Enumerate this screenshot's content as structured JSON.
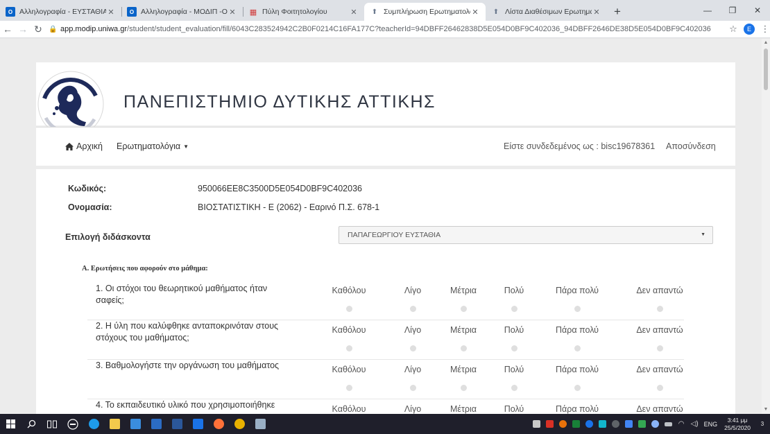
{
  "browser": {
    "tabs": [
      {
        "title": "Αλληλογραφία - ΕΥΣΤΑΘΙΑ ΠΑΠ",
        "favicon": "outlook-icon",
        "active": false
      },
      {
        "title": "Αλληλογραφία - ΜΟΔΙΠ -Outlo",
        "favicon": "outlook-icon",
        "active": false
      },
      {
        "title": "Πύλη Φοιτητολογίου",
        "favicon": "portal-icon",
        "active": false
      },
      {
        "title": "Συμπλήρωση Ερωτηματολογίου",
        "favicon": "modip-icon",
        "active": true
      },
      {
        "title": "Λίστα Διαθέσιμων Ερωτηματολ",
        "favicon": "modip-icon",
        "active": false
      }
    ],
    "url_host": "app.modip.uniwa.gr",
    "url_path": "/student/student_evaluation/fill/6043C283524942C2B0F0214C16FA177C?teacherId=94DBFF26462838D5E054D0BF9C402036_94DBFF2646DE38D5E054D0BF9C402036",
    "profile_initial": "E"
  },
  "header": {
    "university_name": "ΠΑΝΕΠΙΣΤΗΜΙΟ ΔΥΤΙΚΗΣ ΑΤΤΙΚΗΣ"
  },
  "nav": {
    "home": "Αρχική",
    "questionnaires": "Ερωτηματολόγια",
    "logged_in_as": "Είστε συνδεδεμένος ως : bisc19678361",
    "logout": "Αποσύνδεση"
  },
  "course": {
    "code_label": "Κωδικός:",
    "code_value": "950066EE8C3500D5E054D0BF9C402036",
    "name_label": "Ονομασία:",
    "name_value": "ΒΙΟΣΤΑΤΙΣΤΙΚΗ - Ε (2062) - Εαρινό Π.Σ. 678-1",
    "teacher_label": "Επιλογή διδάσκοντα",
    "teacher_selected": "ΠΑΠΑΓΕΩΡΓΙΟΥ ΕΥΣΤΑΘΙΑ"
  },
  "section_a_title": "Α. Ερωτήσεις που αφορούν στο μάθημα:",
  "answer_options": [
    "Καθόλου",
    "Λίγο",
    "Μέτρια",
    "Πολύ",
    "Πάρα πολύ",
    "Δεν απαντώ"
  ],
  "questions": [
    {
      "text": "1. Οι στόχοι του θεωρητικού μαθήματος ήταν σαφείς;"
    },
    {
      "text": "2. Η ύλη που καλύφθηκε ανταποκρινόταν στους στόχους του μαθήματος;"
    },
    {
      "text": "3. Βαθμολογήστε την οργάνωση του μαθήματος"
    },
    {
      "text": "4. Το εκπαιδευτικό υλικό που χρησιμοποιήθηκε"
    }
  ],
  "taskbar": {
    "language": "ENG",
    "time": "3:41 μμ",
    "date": "25/5/2020",
    "notification_count": "3"
  },
  "colors": {
    "primary_text": "#333333",
    "radio_fill": "#dfdfdf",
    "taskbar": "#1f1f2b",
    "page_bg": "#ececec"
  }
}
